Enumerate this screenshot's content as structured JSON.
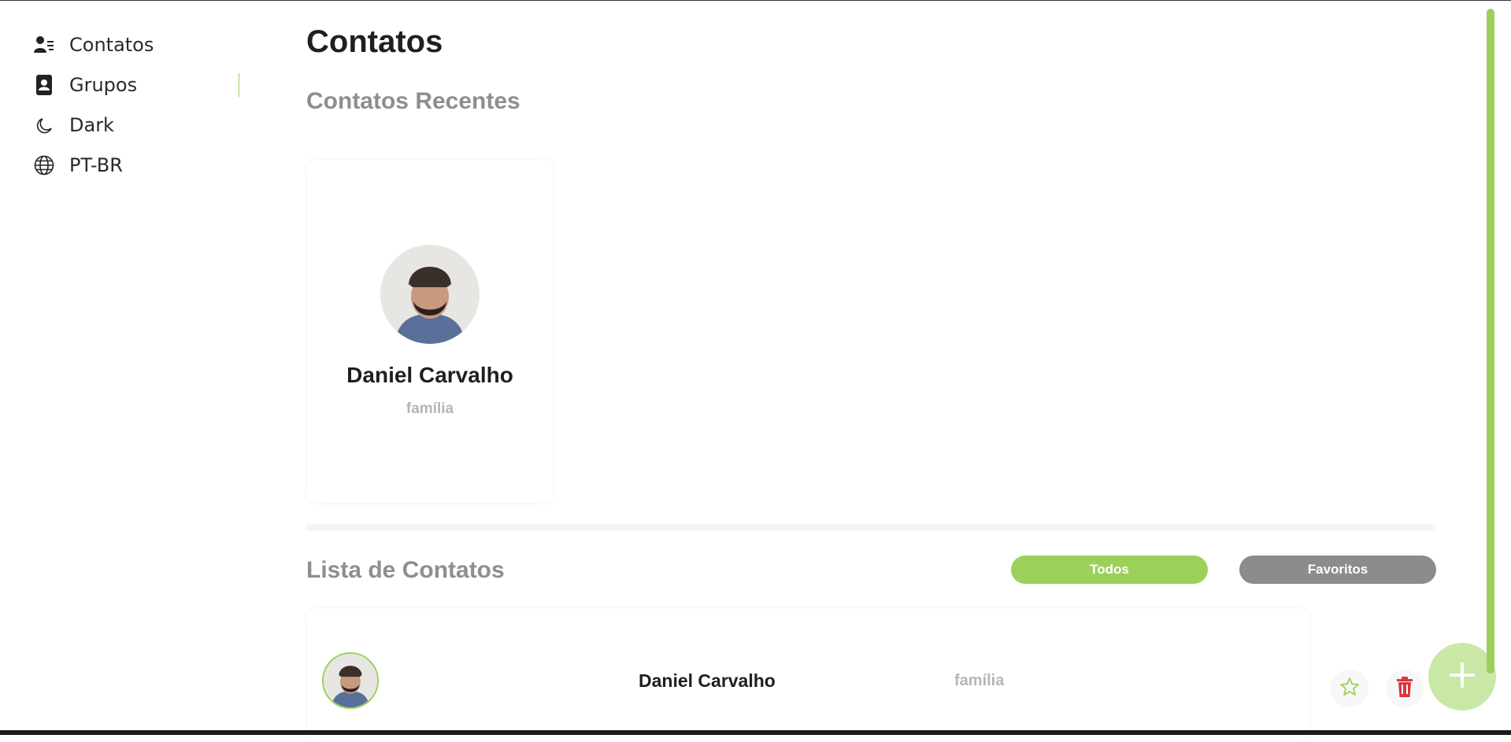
{
  "sidebar": {
    "items": [
      {
        "label": "Contatos",
        "icon": "contacts-list-icon"
      },
      {
        "label": "Grupos",
        "icon": "address-book-icon"
      },
      {
        "label": "Dark",
        "icon": "moon-icon"
      },
      {
        "label": "PT-BR",
        "icon": "globe-icon"
      }
    ],
    "active_index": 1
  },
  "main": {
    "title": "Contatos",
    "recent_title": "Contatos Recentes",
    "recent": [
      {
        "name": "Daniel Carvalho",
        "group": "família"
      }
    ],
    "list_title": "Lista de Contatos",
    "filters": {
      "all_label": "Todos",
      "favorites_label": "Favoritos"
    },
    "contacts": [
      {
        "name": "Daniel Carvalho",
        "group": "família"
      }
    ],
    "fab_label": "+"
  },
  "colors": {
    "accent": "#9bd15a",
    "accent_light": "#c9e8a6",
    "muted_button": "#8c8c8c",
    "delete": "#d9363e",
    "section_title": "#8e8e8e"
  }
}
